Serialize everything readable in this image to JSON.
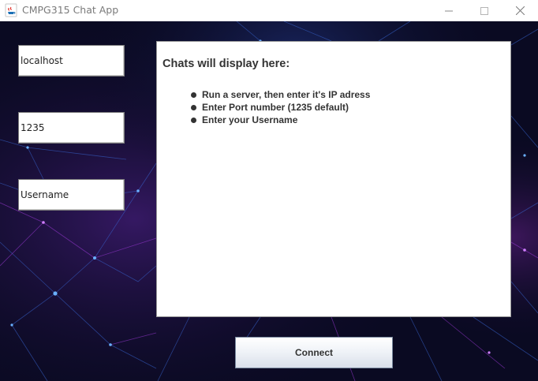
{
  "window": {
    "title": "CMPG315 Chat App",
    "icon": "java-cup-icon",
    "controls": [
      "minimize-icon",
      "maximize-icon",
      "close-icon"
    ]
  },
  "form": {
    "host_value": "localhost",
    "port_value": "1235",
    "username_value": "Username"
  },
  "chat": {
    "heading": "Chats will display here:",
    "instructions": [
      "Run a server, then enter it's IP adress",
      "Enter Port number (1235 default)",
      "Enter your Username"
    ]
  },
  "actions": {
    "connect_label": "Connect"
  },
  "colors": {
    "background": "#0a0a22",
    "network_blue": "#2f7fe0",
    "network_purple": "#a43ce0",
    "panel": "#ffffff"
  }
}
